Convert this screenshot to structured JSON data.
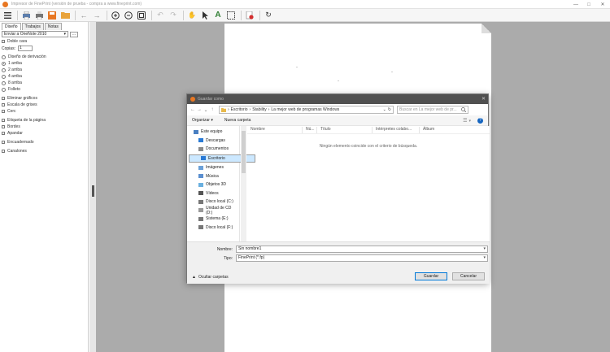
{
  "window": {
    "title": "Impresor de FinePrint (versión de prueba - compra a www.fineprint.com)",
    "accent": "#e87722"
  },
  "toolbar": {
    "icons": [
      "menu-icon",
      "print-icon",
      "printer-icon",
      "save-icon",
      "open-folder-icon",
      "back-arrow-icon",
      "forward-arrow-icon",
      "zoom-in-icon",
      "zoom-out-icon",
      "fit-page-icon",
      "undo-icon",
      "redo-icon",
      "hand-icon",
      "pointer-icon",
      "text-tool-icon",
      "select-tool-icon",
      "delete-page-icon",
      "refresh-icon"
    ]
  },
  "sidebar": {
    "tabs": [
      "Diseño",
      "Trabajos",
      "Notas"
    ],
    "printer_select": "Enviar a OneNote 2010",
    "more_label": "...",
    "doble_cara": "Doble cara",
    "copies_label": "Copias:",
    "copies_value": "1",
    "layout_options": [
      "Diseño de derivación",
      "1 arriba",
      "2 arriba",
      "4 arriba",
      "8 arriba",
      "Folleto"
    ],
    "layout_selected": 1,
    "options_a": [
      "Eliminar gráficos",
      "Escala de grises",
      "Cerc"
    ],
    "options_b": [
      "Etiqueta de la página",
      "Bordes",
      "Apandar"
    ],
    "option_c": "Encuadernado",
    "option_d": "Canalones"
  },
  "dialog": {
    "title": "Guardar como",
    "address": [
      "Escritorio",
      "Stability",
      "La mejor web de programas Windows"
    ],
    "search_placeholder": "Buscar en La mejor web de pr...",
    "organize": "Organizar",
    "new_folder": "Nueva carpeta",
    "nav_items": [
      {
        "label": "Este equipo",
        "icon": "computer-icon"
      },
      {
        "label": "Descargas",
        "icon": "download-icon"
      },
      {
        "label": "Documentos",
        "icon": "documents-icon"
      },
      {
        "label": "Escritorio",
        "icon": "desktop-icon"
      },
      {
        "label": "Imágenes",
        "icon": "pictures-icon"
      },
      {
        "label": "Música",
        "icon": "music-icon"
      },
      {
        "label": "Objetos 3D",
        "icon": "cube-icon"
      },
      {
        "label": "Vídeos",
        "icon": "video-icon"
      },
      {
        "label": "Disco local (C:)",
        "icon": "drive-icon"
      },
      {
        "label": "Unidad de CD (D:)",
        "icon": "cd-icon"
      },
      {
        "label": "Sistema (E:)",
        "icon": "drive-icon"
      },
      {
        "label": "Disco local (F:)",
        "icon": "drive-icon"
      }
    ],
    "nav_selected": 3,
    "columns": [
      "Nombre",
      "Nú...",
      "Título",
      "Intérpretes colabo...",
      "Álbum"
    ],
    "empty_message": "Ningún elemento coincide con el criterio de búsqueda.",
    "filename_label": "Nombre:",
    "filename_value": "Sin nombre1",
    "type_label": "Tipo:",
    "type_value": "FinePrint (*.fp)",
    "hide_folders": "Ocultar carpetas",
    "save": "Guardar",
    "cancel": "Cancelar"
  }
}
